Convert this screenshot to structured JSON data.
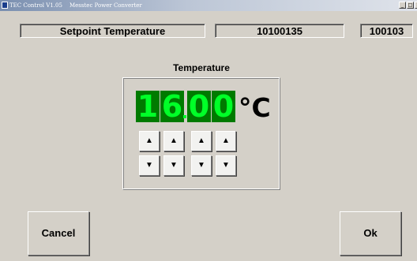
{
  "titlebar": {
    "app_title": "TEC Control V1.05",
    "subtitle": "Messtec Power Converter",
    "controls": {
      "minimize_icon": "minimize-icon",
      "maximize_icon": "maximize-icon",
      "close_icon": "close-icon"
    }
  },
  "header": {
    "setpoint_label": "Setpoint Temperature",
    "serial_number": "10100135",
    "device_code": "100103"
  },
  "temperature": {
    "label": "Temperature",
    "digits": [
      "1",
      "6",
      "0",
      "0"
    ],
    "value": "16.00",
    "unit": "°C"
  },
  "steppers": {
    "up_symbol": "▲",
    "down_symbol": "▼"
  },
  "buttons": {
    "cancel": "Cancel",
    "ok": "Ok"
  },
  "colors": {
    "window_bg": "#d4d0c8",
    "digit_bg": "#007a00",
    "digit_fg": "#00ff28"
  }
}
